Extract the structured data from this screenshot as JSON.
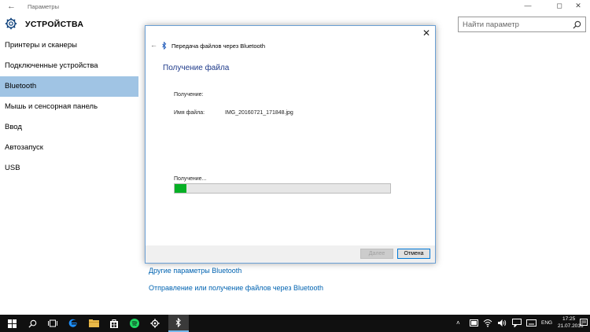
{
  "window": {
    "title": "Параметры",
    "back_glyph": "←",
    "minimize_glyph": "—",
    "maximize_glyph": "◻",
    "close_glyph": "✕"
  },
  "header": {
    "section_title": "УСТРОЙСТВА",
    "icon": "gear-icon"
  },
  "search": {
    "placeholder": "Найти параметр",
    "icon": "search-icon"
  },
  "sidebar": {
    "items": [
      {
        "label": "Принтеры и сканеры",
        "active": false
      },
      {
        "label": "Подключенные устройства",
        "active": false
      },
      {
        "label": "Bluetooth",
        "active": true
      },
      {
        "label": "Мышь и сенсорная панель",
        "active": false
      },
      {
        "label": "Ввод",
        "active": false
      },
      {
        "label": "Автозапуск",
        "active": false
      },
      {
        "label": "USB",
        "active": false
      }
    ]
  },
  "links": [
    {
      "label": "Другие параметры Bluetooth"
    },
    {
      "label": "Отправление или получение файлов через Bluetooth"
    }
  ],
  "dialog": {
    "title": "Передача файлов через Bluetooth",
    "back_glyph": "←",
    "close_glyph": "✕",
    "heading": "Получение файла",
    "rows": [
      {
        "label": "Получение:",
        "value": ""
      },
      {
        "label": "Имя файла:",
        "value": "IMG_20160721_171848.jpg"
      }
    ],
    "progress_label": "Получение...",
    "progress_fraction": 0.055,
    "buttons": {
      "next": "Далее",
      "cancel": "Отмена"
    }
  },
  "taskbar": {
    "items": [
      {
        "name": "start-icon",
        "active": false
      },
      {
        "name": "search-icon",
        "active": false
      },
      {
        "name": "task-view-icon",
        "active": false
      },
      {
        "name": "edge-icon",
        "active": false
      },
      {
        "name": "file-explorer-icon",
        "active": false
      },
      {
        "name": "store-icon",
        "active": false
      },
      {
        "name": "spotify-icon",
        "active": false
      },
      {
        "name": "settings-icon",
        "active": false
      },
      {
        "name": "bluetooth-icon",
        "active": true
      }
    ],
    "tray": {
      "language": "ENG",
      "time": "17:25",
      "date": "21.07.2016"
    }
  },
  "colors": {
    "accent": "#0078d7",
    "link": "#0063b1",
    "active_nav": "#a0c4e4",
    "progress": "#06b025",
    "taskbar": "#101010"
  }
}
